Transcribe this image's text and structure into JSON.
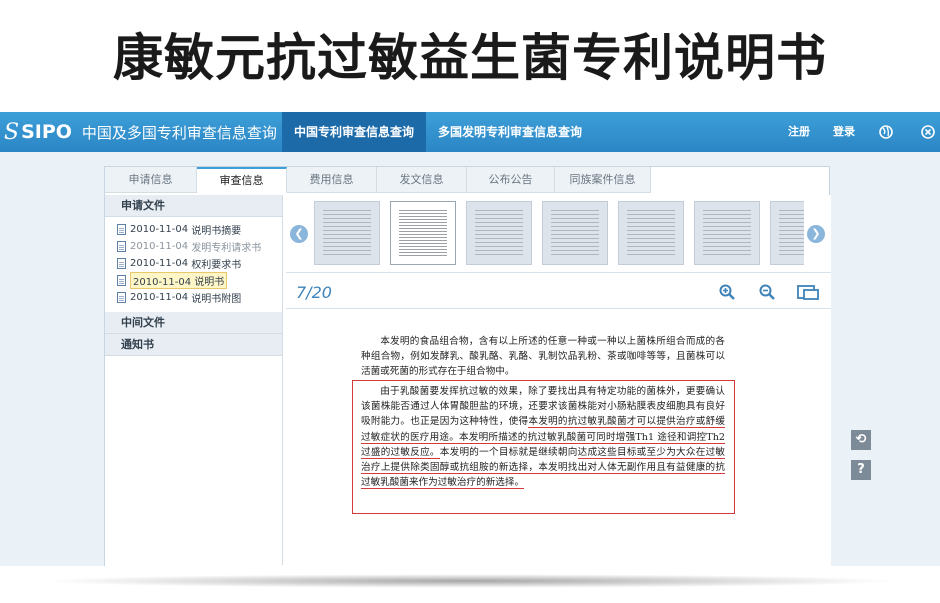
{
  "big_title": "康敏元抗过敏益生菌专利说明书",
  "navbar": {
    "logo_mark": "S",
    "logo_text": "SIPO",
    "logo_sub": "中国及多国专利审查信息查询",
    "tabs": [
      {
        "label": "中国专利审查信息查询",
        "active": true
      },
      {
        "label": "多国发明专利审查信息查询",
        "active": false
      }
    ],
    "register": "注册",
    "login": "登录",
    "globe_icon": "globe-icon",
    "close_icon": "close-icon"
  },
  "tabs": [
    "申请信息",
    "审查信息",
    "费用信息",
    "发文信息",
    "公布公告",
    "同族案件信息"
  ],
  "sidebar": {
    "section1": "申请文件",
    "items": [
      {
        "date": "2010-11-04",
        "name": "说明书摘要"
      },
      {
        "date": "2010-11-04",
        "name": "发明专利请求书"
      },
      {
        "date": "2010-11-04",
        "name": "权利要求书"
      },
      {
        "date": "2010-11-04",
        "name": "说明书"
      },
      {
        "date": "2010-11-04",
        "name": "说明书附图"
      }
    ],
    "section2": "中间文件",
    "section3": "通知书"
  },
  "viewer": {
    "page_indicator": "7/20",
    "zoom_in_icon": "zoom-in-icon",
    "zoom_out_icon": "zoom-out-icon",
    "fit_icon": "fit-window-icon",
    "prev_icon": "chevron-left-icon",
    "next_icon": "chevron-right-icon"
  },
  "document": {
    "para1": "本发明的食品组合物，含有以上所述的任意一种或一种以上菌株所组合而成的各种组合物，例如发酵乳、酸乳酪、乳酪、乳制饮品乳粉、茶或咖啡等等，且菌株可以活菌或死菌的形式存在于组合物中。",
    "para2_a": "由于乳酸菌要发挥抗过敏的效果，除了要找出具有特定功能的菌株外，更要确认该菌株能否通过人体胃酸胆盐的环境，还要求该菌株能对小肠粘膜表皮细胞具有良好吸附能力。也正是因为这种特性，使得",
    "para2_u1": "本发明的抗过敏乳酸菌才可以提供治疗或舒缓过敏症状的医疗用途。本发明所描述的抗过敏乳酸菌可同时增强Th1 途径和调控Th2 过盛的过敏反应。",
    "para2_b": "本发明的一个目标就是继续朝向",
    "para2_u2": "达成这些目标或至少为大众在过敏治疗上提供除类固醇或抗组胺的新选择，本发明找出对人体无副作用且有益健康的抗过敏乳酸菌来作为过敏治疗的新选择。"
  },
  "side_icons": {
    "back_icon": "return-icon",
    "help_icon": "help-icon"
  }
}
